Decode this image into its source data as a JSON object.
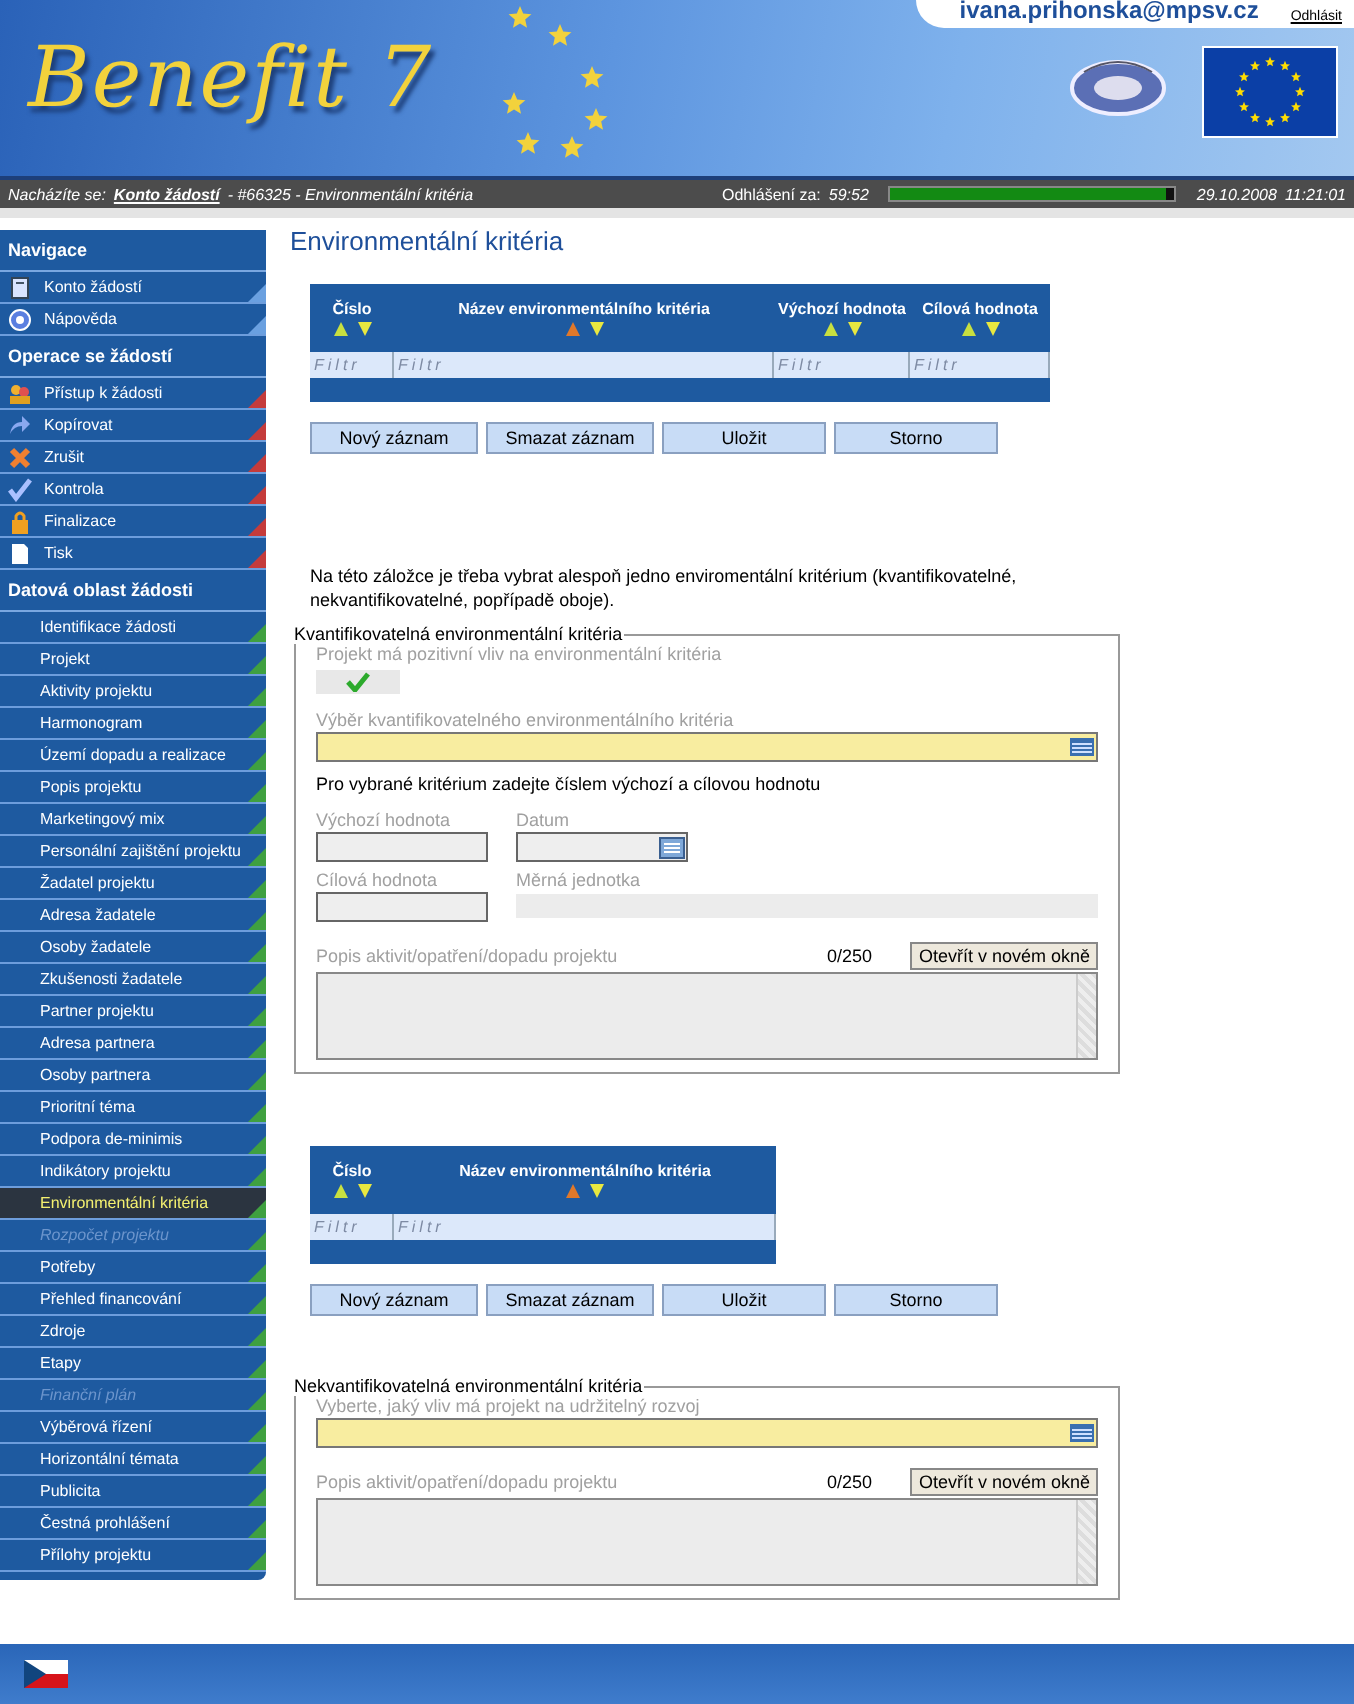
{
  "header": {
    "logo": "Benefit 7",
    "user": "ivana.prihonska@mpsv.cz",
    "logout": "Odhlásit"
  },
  "breadcrumb": {
    "label": "Nacházíte se:",
    "link": "Konto žádostí",
    "rest": "- #66325 - Environmentální kritéria"
  },
  "session": {
    "label": "Odhlášení za:",
    "time": "59:52",
    "level": 0.97,
    "date": "29.10.2008",
    "clock": "11:21:01"
  },
  "sidebar": {
    "sections": [
      {
        "kind": "navigation",
        "title": "Navigace",
        "items": [
          {
            "label": "Konto žádostí",
            "selected": false,
            "disabled": false
          },
          {
            "label": "Nápověda",
            "selected": false,
            "disabled": false
          }
        ]
      },
      {
        "kind": "operations",
        "title": "Operace se žádostí",
        "items": [
          {
            "label": "Přístup k žádosti",
            "selected": false,
            "disabled": false
          },
          {
            "label": "Kopírovat",
            "selected": false,
            "disabled": false
          },
          {
            "label": "Zrušit",
            "selected": false,
            "disabled": false
          },
          {
            "label": "Kontrola",
            "selected": false,
            "disabled": false
          },
          {
            "label": "Finalizace",
            "selected": false,
            "disabled": false
          },
          {
            "label": "Tisk",
            "selected": false,
            "disabled": false
          }
        ]
      },
      {
        "kind": "data",
        "title": "Datová oblast žádosti",
        "items": [
          {
            "label": "Identifikace žádosti",
            "selected": false,
            "disabled": false
          },
          {
            "label": "Projekt",
            "selected": false,
            "disabled": false
          },
          {
            "label": "Aktivity projektu",
            "selected": false,
            "disabled": false
          },
          {
            "label": "Harmonogram",
            "selected": false,
            "disabled": false
          },
          {
            "label": "Území dopadu a realizace",
            "selected": false,
            "disabled": false
          },
          {
            "label": "Popis projektu",
            "selected": false,
            "disabled": false
          },
          {
            "label": "Marketingový mix",
            "selected": false,
            "disabled": false
          },
          {
            "label": "Personální zajištění projektu",
            "selected": false,
            "disabled": false
          },
          {
            "label": "Žadatel projektu",
            "selected": false,
            "disabled": false
          },
          {
            "label": "Adresa žadatele",
            "selected": false,
            "disabled": false
          },
          {
            "label": "Osoby žadatele",
            "selected": false,
            "disabled": false
          },
          {
            "label": "Zkušenosti žadatele",
            "selected": false,
            "disabled": false
          },
          {
            "label": "Partner projektu",
            "selected": false,
            "disabled": false
          },
          {
            "label": "Adresa partnera",
            "selected": false,
            "disabled": false
          },
          {
            "label": "Osoby partnera",
            "selected": false,
            "disabled": false
          },
          {
            "label": "Prioritní téma",
            "selected": false,
            "disabled": false
          },
          {
            "label": "Podpora de-minimis",
            "selected": false,
            "disabled": false
          },
          {
            "label": "Indikátory projektu",
            "selected": false,
            "disabled": false
          },
          {
            "label": "Environmentální kritéria",
            "selected": true,
            "disabled": false
          },
          {
            "label": "Rozpočet projektu",
            "selected": false,
            "disabled": true
          },
          {
            "label": "Potřeby",
            "selected": false,
            "disabled": false
          },
          {
            "label": "Přehled financování",
            "selected": false,
            "disabled": false
          },
          {
            "label": "Zdroje",
            "selected": false,
            "disabled": false
          },
          {
            "label": "Etapy",
            "selected": false,
            "disabled": false
          },
          {
            "label": "Finanční plán",
            "selected": false,
            "disabled": true
          },
          {
            "label": "Výběrová řízení",
            "selected": false,
            "disabled": false
          },
          {
            "label": "Horizontální témata",
            "selected": false,
            "disabled": false
          },
          {
            "label": "Publicita",
            "selected": false,
            "disabled": false
          },
          {
            "label": "Čestná prohlášení",
            "selected": false,
            "disabled": false
          },
          {
            "label": "Přílohy projektu",
            "selected": false,
            "disabled": false
          }
        ]
      }
    ]
  },
  "page_title": "Environmentální kritéria",
  "table_1": {
    "columns": [
      {
        "label": "Číslo",
        "sorted": false,
        "placeholder": "Filtr"
      },
      {
        "label": "Název environmentálního kritéria",
        "sorted": true,
        "placeholder": "Filtr"
      },
      {
        "label": "Výchozí hodnota",
        "sorted": false,
        "placeholder": "Filtr"
      },
      {
        "label": "Cílová hodnota",
        "sorted": false,
        "placeholder": "Filtr"
      }
    ]
  },
  "buttons_1": [
    "Nový záznam",
    "Smazat záznam",
    "Uložit",
    "Storno"
  ],
  "note": "Na této záložce je třeba vybrat alespoň jedno enviromentální kritérium (kvantifikovatelné, nekvantifikovatelné, popřípadě oboje).",
  "quantifiable": {
    "legend": "Kvantifikovatelná environmentální kritéria",
    "positive": {
      "label": "Projekt má pozitivní vliv na environmentální kritéria",
      "checked": true
    },
    "select_label": "Výběr kvantifikovatelného environmentálního kritéria",
    "instruction": "Pro vybrané kritérium zadejte číslem výchozí a cílovou hodnotu",
    "start_label": "Výchozí hodnota",
    "date_label": "Datum",
    "target_label": "Cílová hodnota",
    "unit_label": "Měrná jednotka",
    "description_label": "Popis aktivit/opatření/dopadu projektu",
    "counter": "0/250",
    "open_button": "Otevřít v novém okně"
  },
  "table_2": {
    "columns": [
      {
        "label": "Číslo",
        "sorted": false,
        "placeholder": "Filtr"
      },
      {
        "label": "Název environmentálního kritéria",
        "sorted": true,
        "placeholder": "Filtr"
      }
    ]
  },
  "buttons_2": [
    "Nový záznam",
    "Smazat záznam",
    "Uložit",
    "Storno"
  ],
  "nonquantifiable": {
    "legend": "Nekvantifikovatelná environmentální kritéria",
    "select_label": "Vyberte, jaký vliv má projekt na udržitelný rozvoj",
    "description_label": "Popis aktivit/opatření/dopadu projektu",
    "counter": "0/250",
    "open_button": "Otevřít v novém okně"
  }
}
